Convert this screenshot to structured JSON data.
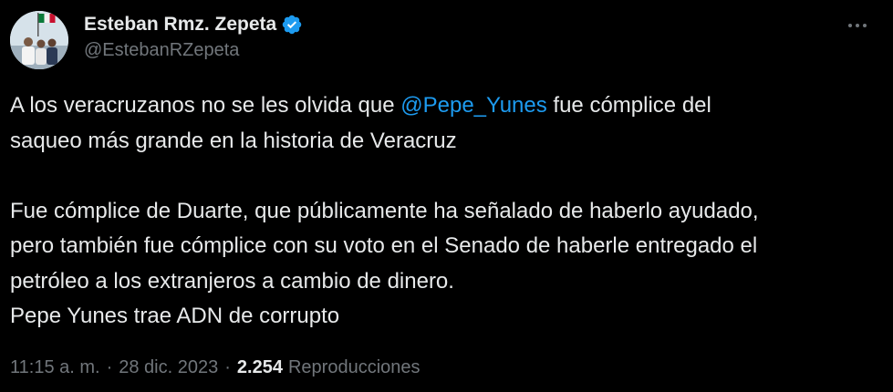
{
  "author": {
    "display_name": "Esteban Rmz. Zepeta",
    "handle": "@EstebanRZepeta",
    "avatar_icon": "profile-photo-with-flag",
    "verified_icon": "verified-badge-icon",
    "verified_color": "#1d9bf0"
  },
  "tweet": {
    "line1_before": "A los veracruzanos no se les olvida que ",
    "mention": "@Pepe_Yunes",
    "line1_after": " fue cómplice del",
    "line2": "saqueo más grande en la historia de Veracruz",
    "line3": "Fue cómplice de Duarte, que públicamente ha señalado de haberlo ayudado,",
    "line4": "pero también fue cómplice con su voto en el Senado de haberle entregado el",
    "line5": "petróleo a los extranjeros a cambio de dinero.",
    "line6": "Pepe Yunes trae ADN de corrupto"
  },
  "meta": {
    "time": "11:15 a. m.",
    "separator": "·",
    "date": "28 dic. 2023",
    "views_count": "2.254",
    "views_label": "Reproducciones"
  },
  "colors": {
    "background": "#000000",
    "text": "#e7e9ea",
    "secondary": "#71767b",
    "link": "#1d9bf0"
  },
  "more_icon": "more-horizontal-icon"
}
